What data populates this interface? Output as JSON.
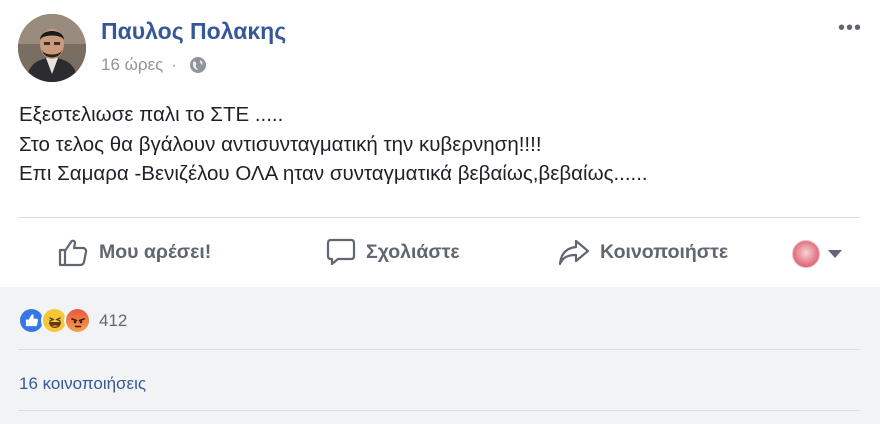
{
  "post": {
    "author": "Παυλος Πολακης",
    "timestamp": "16 ώρες",
    "separator": "·",
    "privacy_icon": "globe-icon",
    "options_icon": "•••",
    "body_lines": [
      "Εξεστελιωσε παλι το ΣΤΕ .....",
      "Στο τελος θα βγάλουν αντισυνταγματική την κυβερνηση!!!!",
      "Επι Σαμαρα -Βενιζέλου ΟΛΑ ηταν συνταγματικά βεβαίως,βεβαίως......"
    ]
  },
  "actions": {
    "like": {
      "label": "Μου αρέσει!",
      "icon": "thumbs-up-icon"
    },
    "comment": {
      "label": "Σχολιάστε",
      "icon": "speech-bubble-icon"
    },
    "share": {
      "label": "Κοινοποιήστε",
      "icon": "share-arrow-icon"
    },
    "audience": {
      "icon": "chevron-down-icon"
    }
  },
  "reactions": {
    "types": [
      "like",
      "haha",
      "angry"
    ],
    "count": "412"
  },
  "shares": {
    "label": "16 κοινοποιήσεις"
  },
  "colors": {
    "author_link": "#365899",
    "secondary_text": "#90949c",
    "action_text": "#606770",
    "like_blue": "#3578e5",
    "haha_yellow": "#f7c73a",
    "angry_red": "#e9573f",
    "footer_bg": "#f2f3f5"
  }
}
